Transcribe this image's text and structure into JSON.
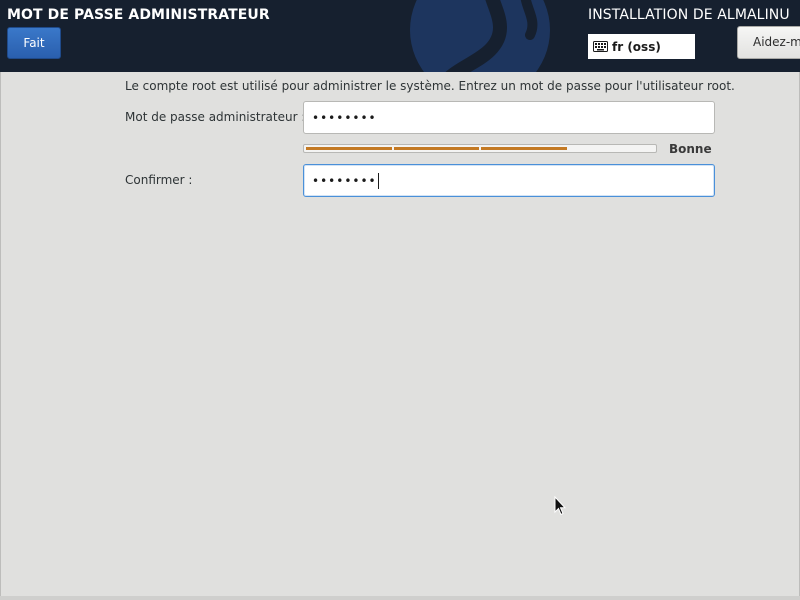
{
  "header": {
    "page_title": "MOT DE PASSE ADMINISTRATEUR",
    "done_label": "Fait",
    "installer_title": "INSTALLATION DE ALMALINU",
    "keyboard_layout": "fr (oss)",
    "help_label": "Aidez-m"
  },
  "form": {
    "description": "Le compte root est utilisé pour administrer le système. Entrez un mot de passe pour l'utilisateur root.",
    "password_label": "Mot de passe administrateur :",
    "password_value": "••••••••",
    "confirm_label": "Confirmer :",
    "confirm_value": "••••••••",
    "strength": {
      "label": "Bonne",
      "level": 3,
      "max": 4,
      "color": "#c47a24"
    }
  },
  "colors": {
    "header_bg": "#16202f",
    "content_bg": "#e0e0de",
    "accent": "#3a78c9"
  },
  "icons": {
    "keyboard": "keyboard-icon",
    "logo": "installer-logo-icon",
    "cursor": "mouse-pointer-icon"
  }
}
